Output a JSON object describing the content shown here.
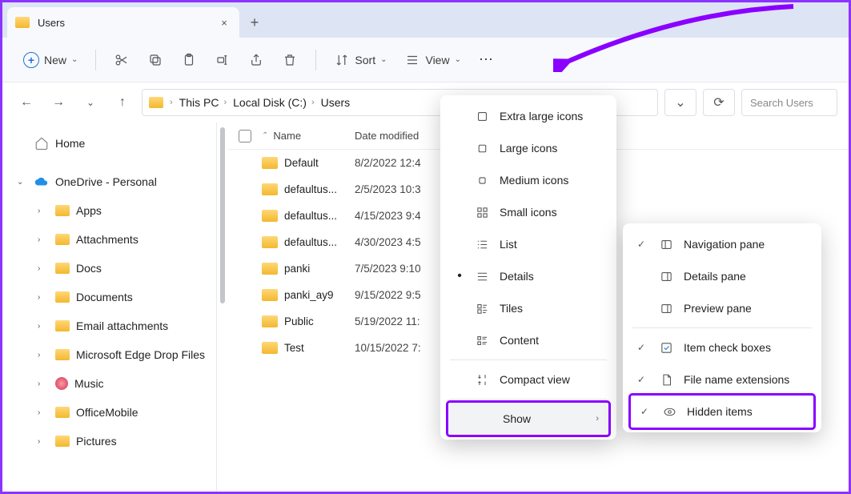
{
  "tab": {
    "title": "Users",
    "add": "+",
    "close": "×"
  },
  "toolbar": {
    "new": "New",
    "sort": "Sort",
    "view": "View",
    "more": "⋯"
  },
  "nav": {
    "back": "←",
    "fwd": "→",
    "recent": "⌄",
    "up": "↑",
    "refresh": "⟳"
  },
  "breadcrumb": [
    "This PC",
    "Local Disk (C:)",
    "Users"
  ],
  "search": {
    "placeholder": "Search Users"
  },
  "sidebar": {
    "home": "Home",
    "onedrive": "OneDrive - Personal",
    "items": [
      "Apps",
      "Attachments",
      "Docs",
      "Documents",
      "Email attachments",
      "Microsoft Edge Drop Files",
      "Music",
      "OfficeMobile",
      "Pictures"
    ]
  },
  "columns": {
    "name": "Name",
    "date": "Date modified"
  },
  "rows": [
    {
      "name": "Default",
      "date": "8/2/2022 12:4"
    },
    {
      "name": "defaultus...",
      "date": "2/5/2023 10:3"
    },
    {
      "name": "defaultus...",
      "date": "4/15/2023 9:4"
    },
    {
      "name": "defaultus...",
      "date": "4/30/2023 4:5"
    },
    {
      "name": "panki",
      "date": "7/5/2023 9:10"
    },
    {
      "name": "panki_ay9",
      "date": "9/15/2022 9:5"
    },
    {
      "name": "Public",
      "date": "5/19/2022 11:"
    },
    {
      "name": "Test",
      "date": "10/15/2022 7:"
    }
  ],
  "viewMenu": {
    "items": [
      {
        "label": "Extra large icons",
        "icon": "xl"
      },
      {
        "label": "Large icons",
        "icon": "l"
      },
      {
        "label": "Medium icons",
        "icon": "m"
      },
      {
        "label": "Small icons",
        "icon": "s"
      },
      {
        "label": "List",
        "icon": "list"
      },
      {
        "label": "Details",
        "icon": "details",
        "selected": true
      },
      {
        "label": "Tiles",
        "icon": "tiles"
      },
      {
        "label": "Content",
        "icon": "content"
      }
    ],
    "compact": "Compact view",
    "show": "Show"
  },
  "showMenu": {
    "items": [
      {
        "label": "Navigation pane",
        "checked": true,
        "icon": "navpane"
      },
      {
        "label": "Details pane",
        "checked": false,
        "icon": "detpane"
      },
      {
        "label": "Preview pane",
        "checked": false,
        "icon": "prevpane"
      }
    ],
    "items2": [
      {
        "label": "Item check boxes",
        "checked": true,
        "icon": "checkbox"
      },
      {
        "label": "File name extensions",
        "checked": true,
        "icon": "file"
      },
      {
        "label": "Hidden items",
        "checked": true,
        "icon": "eye",
        "highlight": true
      }
    ]
  }
}
